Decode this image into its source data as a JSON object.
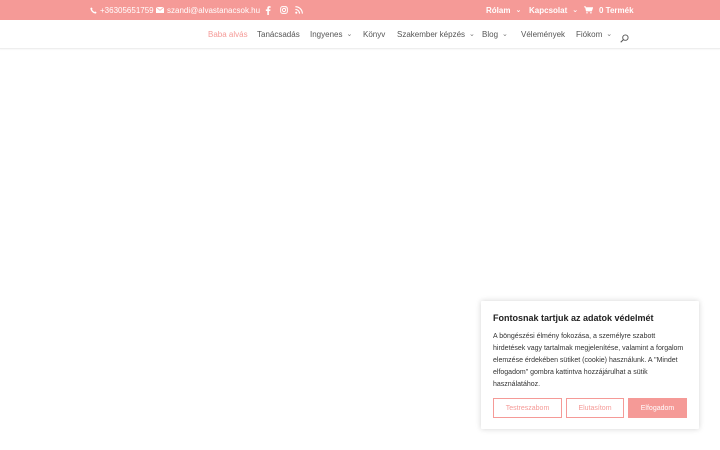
{
  "topbar": {
    "phone": "+36305651759",
    "email": "szandi@alvastanacsok.hu",
    "about": "Rólam",
    "contact": "Kapcsolat",
    "cart": "0 Termék"
  },
  "nav": {
    "items": [
      {
        "label": "Baba alvás"
      },
      {
        "label": "Tanácsadás"
      },
      {
        "label": "Ingyenes"
      },
      {
        "label": "Könyv"
      },
      {
        "label": "Szakember képzés"
      },
      {
        "label": "Blog"
      },
      {
        "label": "Vélemények"
      },
      {
        "label": "Fiókom"
      }
    ]
  },
  "cookie": {
    "title": "Fontosnak tartjuk az adatok védelmét",
    "text": "A böngészési élmény fokozása, a személyre szabott hirdetések vagy tartalmak megjelenítése, valamint a forgalom elemzése érdekében sütiket (cookie) használunk. A \"Mindet elfogadom\" gombra kattintva hozzájárulhat a sütik használatához.",
    "customize": "Testreszabom",
    "reject": "Elutasítom",
    "accept": "Elfogadom"
  },
  "colors": {
    "accent": "#f59a97"
  }
}
